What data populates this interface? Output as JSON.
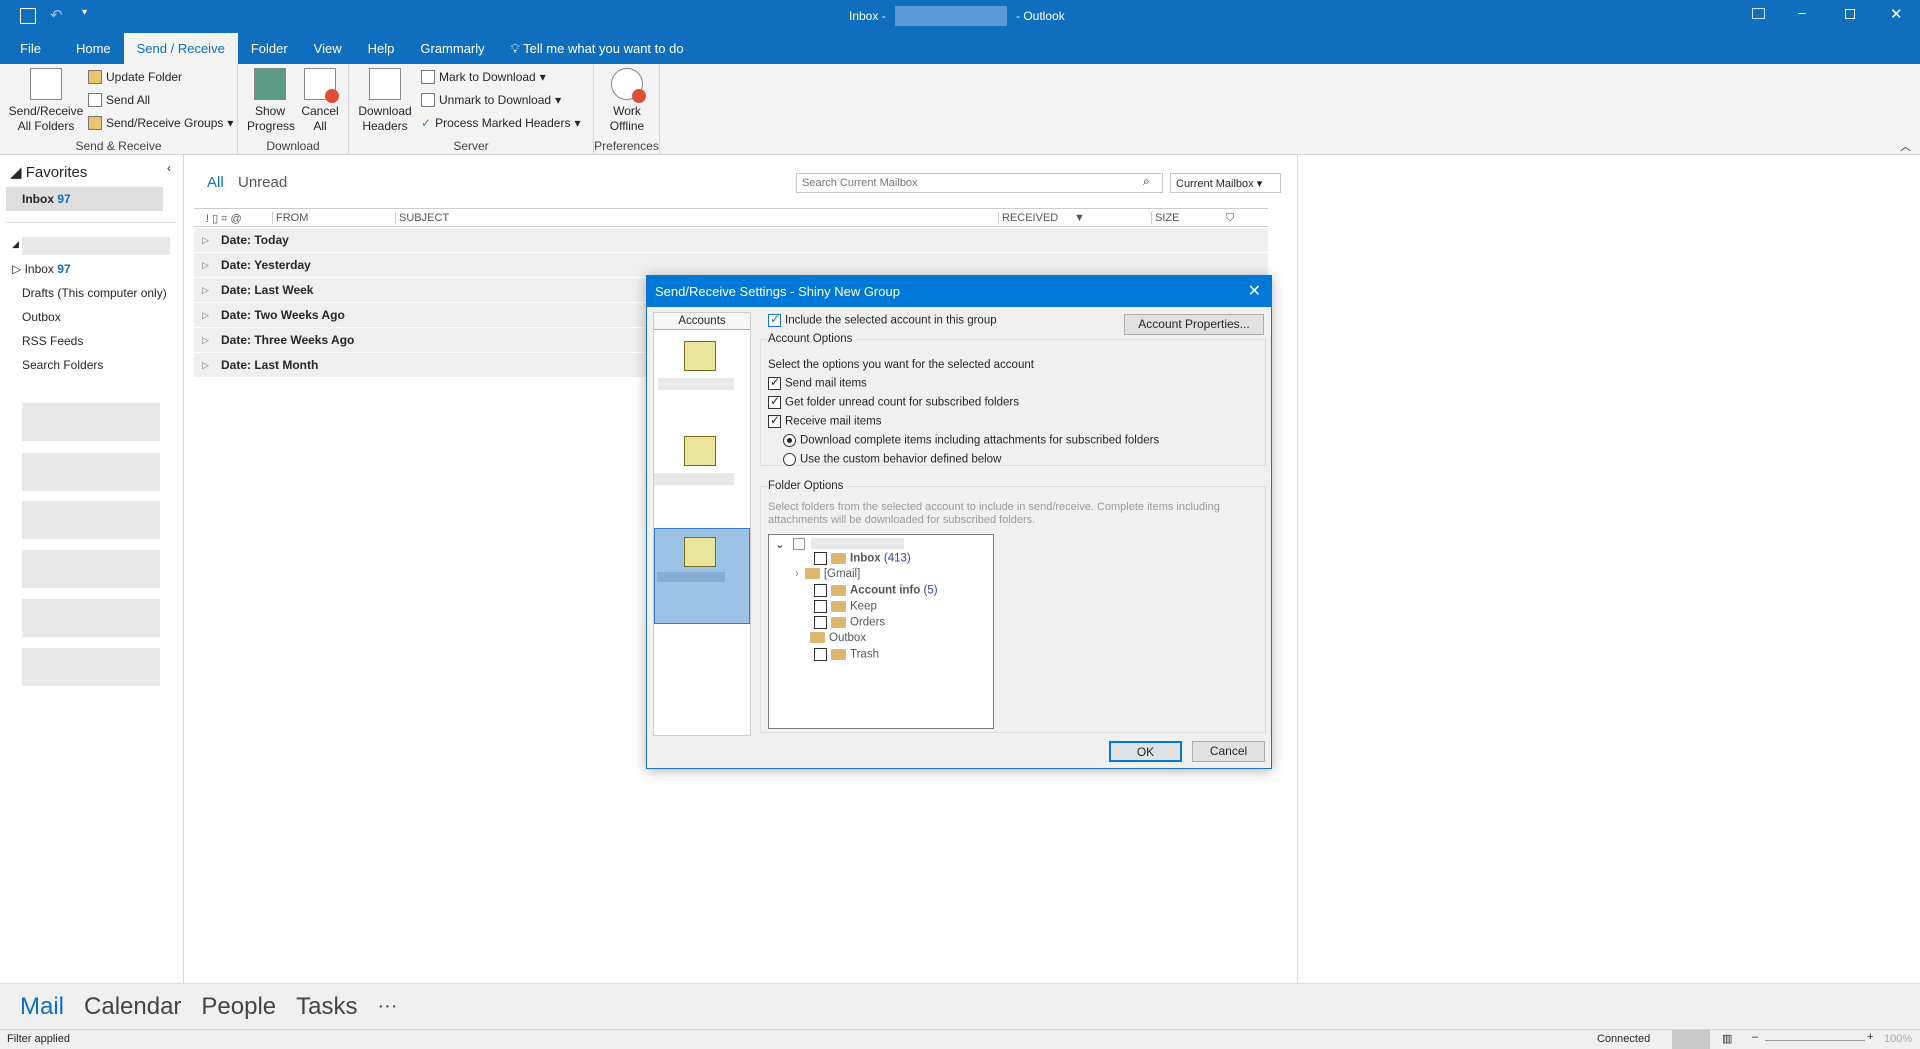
{
  "window": {
    "title": "Inbox -",
    "app": "Outlook"
  },
  "tabs": [
    "File",
    "Home",
    "Send / Receive",
    "Folder",
    "View",
    "Help",
    "Grammarly"
  ],
  "active_tab": "Send / Receive",
  "tell_me": "Tell me what you want to do",
  "ribbon": {
    "send_receive_all": "Send/Receive All Folders",
    "update_folder": "Update Folder",
    "send_all": "Send All",
    "groups": "Send/Receive Groups",
    "group1": "Send & Receive",
    "show_progress": "Show Progress",
    "cancel_all": "Cancel All",
    "group2": "Download",
    "download_headers": "Download Headers",
    "mark_download": "Mark to Download",
    "unmark_download": "Unmark to Download",
    "process_marked": "Process Marked Headers",
    "group3": "Server",
    "work_offline": "Work Offline",
    "group4": "Preferences"
  },
  "favorites": {
    "label": "Favorites",
    "inbox": "Inbox",
    "inbox_count": "97"
  },
  "folders": [
    {
      "label": "Inbox",
      "count": "97"
    },
    {
      "label": "Drafts (This computer only)"
    },
    {
      "label": "Outbox"
    },
    {
      "label": "RSS Feeds"
    },
    {
      "label": "Search Folders"
    }
  ],
  "filter": {
    "all": "All",
    "unread": "Unread"
  },
  "search": {
    "placeholder": "Search Current Mailbox",
    "scope": "Current Mailbox"
  },
  "columns": {
    "from": "FROM",
    "subject": "SUBJECT",
    "received": "RECEIVED",
    "size": "SIZE"
  },
  "groups": [
    "Date: Today",
    "Date: Yesterday",
    "Date: Last Week",
    "Date: Two Weeks Ago",
    "Date: Three Weeks Ago",
    "Date: Last Month"
  ],
  "dialog": {
    "title": "Send/Receive Settings - Shiny New Group",
    "accounts_header": "Accounts",
    "include": "Include the selected account in this group",
    "include_checked": true,
    "account_properties": "Account Properties...",
    "account_options": "Account Options",
    "select_options": "Select the options you want for the selected account",
    "send_mail": "Send mail items",
    "get_unread": "Get folder unread count for subscribed folders",
    "receive_mail": "Receive mail items",
    "download_complete": "Download complete items including attachments for subscribed folders",
    "custom_behavior": "Use the custom behavior defined below",
    "selected_radio": "download_complete",
    "folder_options": "Folder Options",
    "folder_desc": "Select folders from the selected account to include in send/receive. Complete items including attachments will be downloaded for subscribed folders.",
    "tree": [
      {
        "label": "Inbox",
        "count": "(413)",
        "bold": true
      },
      {
        "label": "[Gmail]"
      },
      {
        "label": "Account info",
        "count": "(5)",
        "bold": true
      },
      {
        "label": "Keep"
      },
      {
        "label": "Orders"
      },
      {
        "label": "Outbox"
      },
      {
        "label": "Trash"
      }
    ],
    "ok": "OK",
    "cancel": "Cancel"
  },
  "bottom_nav": [
    "Mail",
    "Calendar",
    "People",
    "Tasks",
    "···"
  ],
  "status": {
    "left": "Filter applied",
    "connection": "Connected",
    "zoom": "100%"
  },
  "colors": {
    "accent": "#106ebe",
    "dialog_title": "#0078d7",
    "selected_account": "#9cc3e5"
  }
}
